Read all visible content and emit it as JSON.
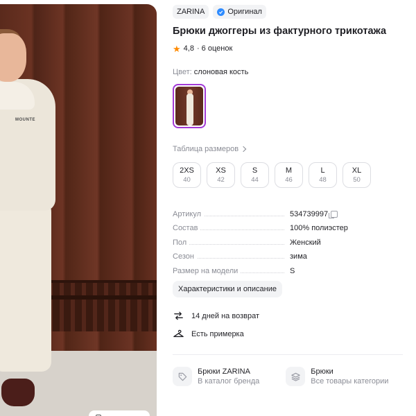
{
  "photo": {
    "logo_text": "MOUNTE",
    "alt": "product-photo"
  },
  "brand": {
    "name": "ZARINA",
    "original_label": "Оригинал"
  },
  "product": {
    "title": "Брюки джоггеры из фактурного трикотажа",
    "rating": "4,8",
    "reviews": "· 6 оценок"
  },
  "color": {
    "label": "Цвет:",
    "value": "слоновая кость"
  },
  "size_table_link": "Таблица размеров",
  "sizes": [
    {
      "size": "2XS",
      "ru": "40"
    },
    {
      "size": "XS",
      "ru": "42"
    },
    {
      "size": "S",
      "ru": "44"
    },
    {
      "size": "M",
      "ru": "46"
    },
    {
      "size": "L",
      "ru": "48"
    },
    {
      "size": "XL",
      "ru": "50"
    }
  ],
  "specs": [
    {
      "key": "Артикул",
      "value": "534739997"
    },
    {
      "key": "Состав",
      "value": "100% полиэстер"
    },
    {
      "key": "Пол",
      "value": "Женский"
    },
    {
      "key": "Сезон",
      "value": "зима"
    },
    {
      "key": "Размер на модели",
      "value": "S"
    }
  ],
  "details_button": "Характеристики и описание",
  "features": [
    {
      "text": "14 дней на возврат",
      "icon": "return-arrows-icon"
    },
    {
      "text": "Есть примерка",
      "icon": "hanger-icon"
    }
  ],
  "cards": [
    {
      "title": "Брюки ZARINA",
      "subtitle": "В каталог бренда",
      "icon": "tag-icon"
    },
    {
      "title": "Брюки",
      "subtitle": "Все товары категории",
      "icon": "layers-icon"
    }
  ],
  "colors": {
    "accent": "#a23ad6",
    "verified": "#2f8cff",
    "star": "#ff8a00",
    "muted": "#8a8c95"
  }
}
